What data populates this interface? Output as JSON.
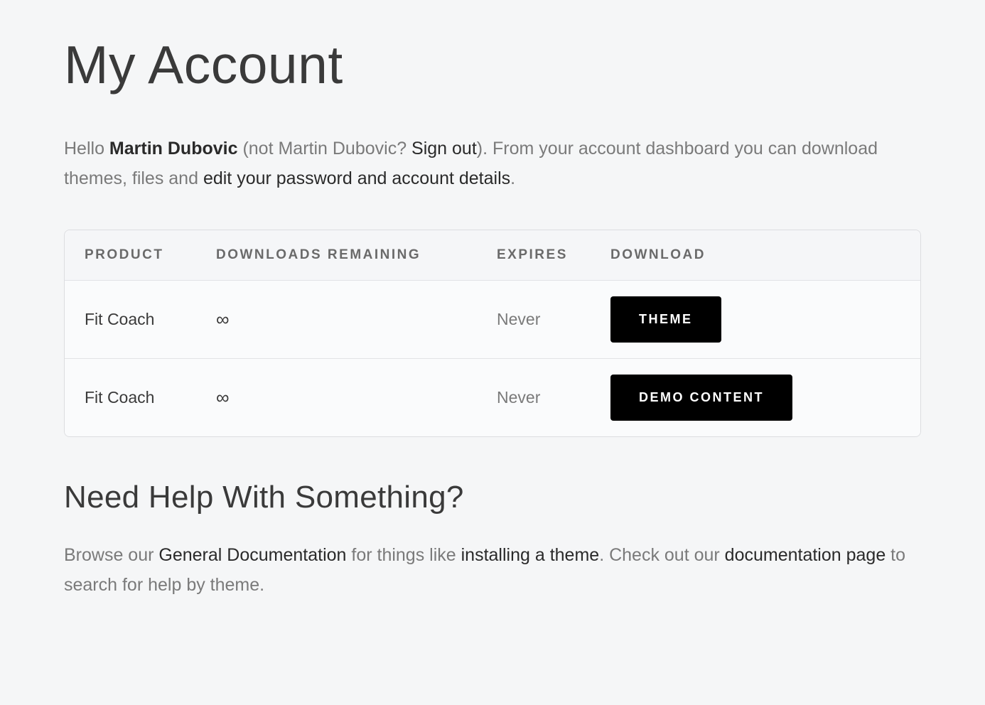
{
  "page_title": "My Account",
  "intro": {
    "greeting_prefix": "Hello ",
    "user_name": "Martin Dubovic",
    "not_user_prefix": " (not Martin Dubovic? ",
    "sign_out_text": "Sign out",
    "not_user_suffix": "). From your account dashboard you can download themes, files and ",
    "edit_link_text": "edit your password and account details",
    "intro_suffix": "."
  },
  "table": {
    "headers": {
      "product": "PRODUCT",
      "downloads_remaining": "DOWNLOADS REMAINING",
      "expires": "EXPIRES",
      "download": "DOWNLOAD"
    },
    "rows": [
      {
        "product": "Fit Coach",
        "downloads_remaining": "∞",
        "expires": "Never",
        "download_label": "THEME"
      },
      {
        "product": "Fit Coach",
        "downloads_remaining": "∞",
        "expires": "Never",
        "download_label": "DEMO CONTENT"
      }
    ]
  },
  "help": {
    "heading": "Need Help With Something?",
    "text_prefix": "Browse our ",
    "general_doc_link": "General Documentation",
    "text_mid1": " for things like ",
    "installing_link": "installing a theme",
    "text_mid2": ". Check out our ",
    "doc_page_link": "documentation page",
    "text_suffix": " to search for help by theme."
  }
}
